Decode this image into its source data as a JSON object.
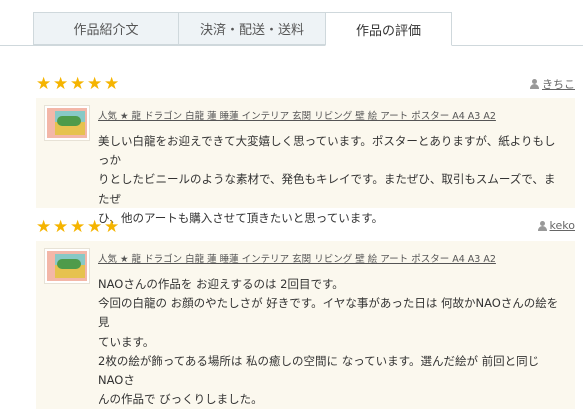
{
  "tabs": [
    {
      "label": "作品紹介文",
      "active": false
    },
    {
      "label": "決済・配送・送料",
      "active": false
    },
    {
      "label": "作品の評価",
      "active": true
    }
  ],
  "colors": {
    "star": "#f5b400",
    "card_bg": "#fbf8ee",
    "tab_bg": "#eef3f6"
  },
  "reviews": [
    {
      "rating": 5,
      "user": "きちこ",
      "item_title": "人気 ★ 龍 ドラゴン 白龍 蓮 睡蓮 インテリア 玄関 リビング 壁 絵 アート ポスター A4 A3 A2",
      "lines": [
        "美しい白龍をお迎えできて大変嬉しく思っています。ポスターとありますが、紙よりもしっか",
        "りとしたビニールのような素材で、発色もキレイです。またぜひ、取引もスムーズで、またぜ",
        "ひ、他のアートも購入させて頂きたいと思っています。"
      ]
    },
    {
      "rating": 5,
      "user": "keko",
      "item_title": "人気 ★ 龍 ドラゴン 白龍 蓮 睡蓮 インテリア 玄関 リビング 壁 絵 アート ポスター A4 A3 A2",
      "lines": [
        "NAOさんの作品を お迎えするのは 2回目です。",
        "今回の白龍の お顔のやたしさが 好きです。イヤな事があった日は 何故かNAOさんの絵を 見",
        "ています。",
        "2枚の絵が飾ってある場所は 私の癒しの空間に なっています。選んだ絵が 前回と同じNAOさ",
        "んの作品で びっくりしました。"
      ]
    }
  ]
}
